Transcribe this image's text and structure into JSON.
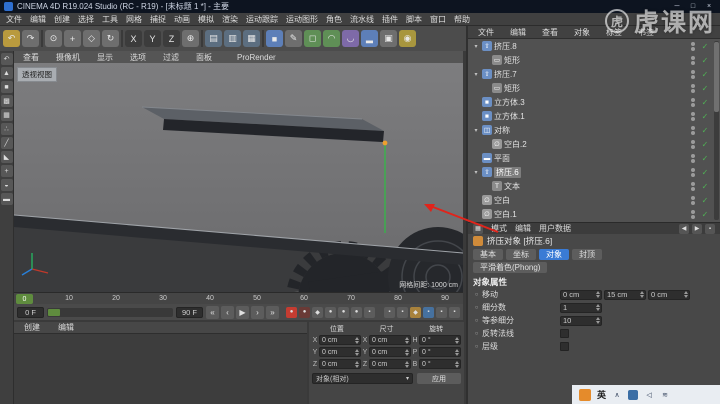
{
  "colors": {
    "accent": "#3a7bd5",
    "green-check": "#4fb254",
    "annotation-red": "#e0241b",
    "playhead-green": "#5f8c3e"
  },
  "title_bar": {
    "title": "CINEMA 4D R19.024 Studio (RC - R19) - [未标题 1 *] - 主要",
    "controls": [
      {
        "name": "minimize-button",
        "glyph": "─"
      },
      {
        "name": "maximize-button",
        "glyph": "□"
      },
      {
        "name": "close-button",
        "glyph": "×"
      }
    ]
  },
  "menu_bar": {
    "items": [
      "文件",
      "编辑",
      "创建",
      "选择",
      "工具",
      "网格",
      "捕捉",
      "动画",
      "模拟",
      "渲染",
      "运动跟踪",
      "运动图形",
      "角色",
      "流水线",
      "插件",
      "脚本",
      "窗口",
      "帮助"
    ]
  },
  "toolbar": {
    "icons": [
      {
        "name": "undo-icon",
        "glyph": "↶",
        "color": "#b99a3e"
      },
      {
        "name": "redo-icon",
        "glyph": "↷",
        "color": "#6e6e6e"
      },
      {
        "name": "separator",
        "cls": "sep",
        "glyph": ""
      },
      {
        "name": "live-selection-icon",
        "glyph": "⊙",
        "color": "#6e6e6e"
      },
      {
        "name": "move-tool-icon",
        "glyph": "+",
        "color": "#6e6e6e"
      },
      {
        "name": "scale-tool-icon",
        "glyph": "◇",
        "color": "#6e6e6e"
      },
      {
        "name": "rotate-tool-icon",
        "glyph": "↻",
        "color": "#6e6e6e"
      },
      {
        "name": "separator",
        "cls": "sep",
        "glyph": ""
      },
      {
        "name": "x-axis-lock-icon",
        "glyph": "X",
        "color": "#3c3c3c"
      },
      {
        "name": "y-axis-lock-icon",
        "glyph": "Y",
        "color": "#3c3c3c"
      },
      {
        "name": "z-axis-lock-icon",
        "glyph": "Z",
        "color": "#3c3c3c"
      },
      {
        "name": "coordinate-system-icon",
        "glyph": "⊕",
        "color": "#6e6e6e"
      },
      {
        "name": "separator",
        "cls": "sep",
        "glyph": ""
      },
      {
        "name": "render-view-icon",
        "glyph": "▤",
        "color": "#5c6e80"
      },
      {
        "name": "render-picture-viewer-icon",
        "glyph": "▥",
        "color": "#5c6e80"
      },
      {
        "name": "render-settings-icon",
        "glyph": "▦",
        "color": "#5c6e80"
      },
      {
        "name": "separator",
        "cls": "sep",
        "glyph": ""
      },
      {
        "name": "primitive-cube-icon",
        "glyph": "■",
        "color": "#5d7fb8"
      },
      {
        "name": "spline-pen-icon",
        "glyph": "✎",
        "color": "#6e6e6e"
      },
      {
        "name": "subdivision-surface-icon",
        "glyph": "◻",
        "color": "#5f8f56"
      },
      {
        "name": "generator-icon",
        "glyph": "◠",
        "color": "#5f8f56"
      },
      {
        "name": "deformer-icon",
        "glyph": "◡",
        "color": "#7e6aa8"
      },
      {
        "name": "environment-icon",
        "glyph": "▂",
        "color": "#5d7fb8"
      },
      {
        "name": "camera-icon",
        "glyph": "▣",
        "color": "#6e6e6e"
      },
      {
        "name": "light-icon",
        "glyph": "◉",
        "color": "#a8963e"
      }
    ]
  },
  "left_toolbar": {
    "icons": [
      {
        "name": "undo-small-icon",
        "glyph": "↶"
      },
      {
        "name": "make-editable-icon",
        "glyph": "▲"
      },
      {
        "name": "model-mode-icon",
        "glyph": "■"
      },
      {
        "name": "texture-mode-icon",
        "glyph": "▩"
      },
      {
        "name": "workplane-mode-icon",
        "glyph": "▦"
      },
      {
        "name": "points-mode-icon",
        "glyph": "∴"
      },
      {
        "name": "edges-mode-icon",
        "glyph": "╱"
      },
      {
        "name": "polygons-mode-icon",
        "glyph": "◣"
      },
      {
        "name": "enable-axis-icon",
        "glyph": "+"
      },
      {
        "name": "snap-mode-icon",
        "glyph": "◒"
      },
      {
        "name": "workplane-lock-icon",
        "glyph": "▬"
      }
    ]
  },
  "viewport": {
    "menus": [
      "查看",
      "摄像机",
      "显示",
      "选项",
      "过滤",
      "面板",
      "ProRender"
    ],
    "view_label": "透视视图",
    "grid_label": "网格间距: 1000 cm"
  },
  "timeline": {
    "ticks": [
      "0",
      "10",
      "20",
      "30",
      "40",
      "50",
      "60",
      "70",
      "80",
      "90"
    ],
    "playhead": "0"
  },
  "transport": {
    "start": "0 F",
    "end": "90 F",
    "buttons": [
      {
        "name": "goto-start-button",
        "glyph": "«"
      },
      {
        "name": "prev-frame-button",
        "glyph": "‹"
      },
      {
        "name": "play-button",
        "glyph": "▶"
      },
      {
        "name": "next-frame-button",
        "glyph": "›"
      },
      {
        "name": "goto-end-button",
        "glyph": "»"
      }
    ],
    "record_icons": [
      {
        "name": "record-keyframe-icon",
        "glyph": "●",
        "color": "#c43c31"
      },
      {
        "name": "autokey-icon",
        "glyph": "●",
        "color": "#6a3a36"
      },
      {
        "name": "keyframe-selection-icon",
        "glyph": "◆",
        "color": "#5c5c5c"
      },
      {
        "name": "record-position-icon",
        "glyph": "●",
        "color": "#5c5c5c"
      },
      {
        "name": "record-scale-icon",
        "glyph": "●",
        "color": "#5c5c5c"
      },
      {
        "name": "record-rotation-icon",
        "glyph": "●",
        "color": "#5c5c5c"
      },
      {
        "name": "point-level-animation-icon",
        "glyph": "▪",
        "color": "#5c5c5c"
      }
    ],
    "right_icons": [
      {
        "name": "playback-mode-icon",
        "glyph": "▪",
        "color": "#5c5c5c"
      },
      {
        "name": "sound-toggle-icon",
        "glyph": "▪",
        "color": "#5c5c5c"
      },
      {
        "name": "magnet-snap-icon",
        "glyph": "◆",
        "color": "#a8823c"
      },
      {
        "name": "workplane-toggle-icon",
        "glyph": "▪",
        "color": "#46719f"
      },
      {
        "name": "quantize-icon",
        "glyph": "▪",
        "color": "#5c5c5c"
      },
      {
        "name": "timeline-options-icon",
        "glyph": "▪",
        "color": "#5c5c5c"
      }
    ]
  },
  "materials": {
    "menus": [
      "创建",
      "编辑"
    ]
  },
  "coordinate_manager": {
    "headers": [
      "位置",
      "尺寸",
      "旋转"
    ],
    "rows": [
      {
        "a1": "X",
        "pos": "0 cm",
        "a2": "X",
        "size": "0 cm",
        "a3": "H",
        "rot": "0 °"
      },
      {
        "a1": "Y",
        "pos": "0 cm",
        "a2": "Y",
        "size": "0 cm",
        "a3": "P",
        "rot": "0 °"
      },
      {
        "a1": "Z",
        "pos": "0 cm",
        "a2": "Z",
        "size": "0 cm",
        "a3": "B",
        "rot": "0 °"
      }
    ],
    "mode_dropdown": "对象(相对)",
    "apply_button": "应用"
  },
  "object_manager": {
    "menus": [
      "文件",
      "编辑",
      "查看",
      "对象",
      "标签",
      "书签"
    ],
    "items": [
      {
        "name": "挤压.8",
        "level": 0,
        "exp": "▾",
        "iglyph": "⇧",
        "icolor": "#6b8fc4",
        "check": "✓"
      },
      {
        "name": "矩形",
        "level": 1,
        "exp": "",
        "iglyph": "▭",
        "icolor": "#8b8b8b",
        "check": "✓"
      },
      {
        "name": "挤压.7",
        "level": 0,
        "exp": "▾",
        "iglyph": "⇧",
        "icolor": "#6b8fc4",
        "check": "✓"
      },
      {
        "name": "矩形",
        "level": 1,
        "exp": "",
        "iglyph": "▭",
        "icolor": "#8b8b8b",
        "check": "✓"
      },
      {
        "name": "立方体.3",
        "level": 0,
        "exp": "",
        "iglyph": "■",
        "icolor": "#6b8fc4",
        "check": "✓"
      },
      {
        "name": "立方体.1",
        "level": 0,
        "exp": "",
        "iglyph": "■",
        "icolor": "#6b8fc4",
        "check": "✓"
      },
      {
        "name": "对称",
        "level": 0,
        "exp": "▾",
        "iglyph": "◫",
        "icolor": "#6b8fc4",
        "check": "✓"
      },
      {
        "name": "空白.2",
        "level": 1,
        "exp": "",
        "iglyph": "∅",
        "icolor": "#9a9a9a",
        "check": "✓"
      },
      {
        "name": "平面",
        "level": 0,
        "exp": "",
        "iglyph": "▬",
        "icolor": "#6b8fc4",
        "check": "✓"
      },
      {
        "name": "挤压.6",
        "level": 0,
        "exp": "▾",
        "state": "sel",
        "iglyph": "⇧",
        "icolor": "#6b8fc4",
        "check": "✓"
      },
      {
        "name": "文本",
        "level": 1,
        "exp": "",
        "iglyph": "T",
        "icolor": "#8b8b8b",
        "check": "✓"
      },
      {
        "name": "空白",
        "level": 0,
        "exp": "",
        "iglyph": "∅",
        "icolor": "#9a9a9a",
        "check": "✓"
      },
      {
        "name": "空白.1",
        "level": 0,
        "exp": "",
        "iglyph": "∅",
        "icolor": "#9a9a9a",
        "check": "✓"
      }
    ]
  },
  "attribute_manager": {
    "menus": [
      "模式",
      "编辑",
      "用户数据"
    ],
    "object_title": "挤压对象 [挤压.6]",
    "tabs": [
      {
        "label": "基本"
      },
      {
        "label": "坐标"
      },
      {
        "label": "对象",
        "state": "active"
      },
      {
        "label": "封顶"
      }
    ],
    "tabs2": [
      {
        "label": "平滑着色(Phong)"
      }
    ],
    "section": "对象属性",
    "props": {
      "move_label": "移动",
      "move_x": "0 cm",
      "move_y": "15 cm",
      "move_z": "0 cm",
      "subdiv_label": "细分数",
      "subdiv_value": "1",
      "iso_label": "等参细分",
      "iso_value": "10",
      "flip_label": "反转法线",
      "hierarchy_label": "层级"
    }
  },
  "watermark": {
    "logo": "虎",
    "text": "虎课网"
  },
  "taskbar": {
    "ime": "英"
  }
}
